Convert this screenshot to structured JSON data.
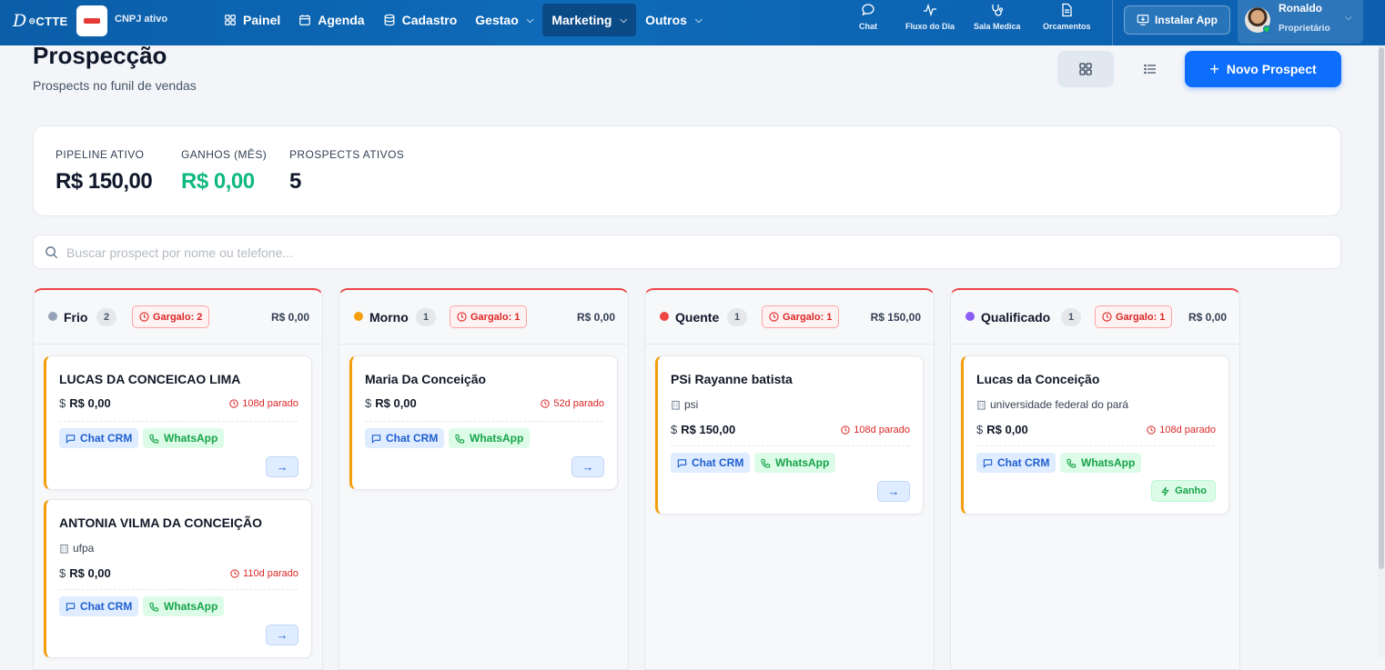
{
  "topbar": {
    "logo_d": "D",
    "logo_text": "CTTE",
    "cnpj_status": "CNPJ ativo",
    "nav": [
      {
        "label": "Painel",
        "icon": "grid-icon"
      },
      {
        "label": "Agenda",
        "icon": "calendar-icon"
      },
      {
        "label": "Cadastro",
        "icon": "database-icon"
      },
      {
        "label": "Gestao",
        "icon": "chevron-down-icon"
      },
      {
        "label": "Marketing",
        "icon": "chevron-down-icon",
        "active": true
      },
      {
        "label": "Outros",
        "icon": "chevron-down-icon"
      }
    ],
    "quick": [
      {
        "label": "Chat",
        "icon": "chat-bubble-icon"
      },
      {
        "label": "Fluxo do Dia",
        "icon": "activity-icon"
      },
      {
        "label": "Sala Medica",
        "icon": "stethoscope-icon"
      },
      {
        "label": "Orcamentos",
        "icon": "document-icon"
      }
    ],
    "install_label": "Instalar App",
    "user": {
      "name": "Ronaldo",
      "role": "Proprietário"
    }
  },
  "page": {
    "title": "Prospecção",
    "subtitle": "Prospects no funil de vendas",
    "new_button": "Novo Prospect"
  },
  "stats": [
    {
      "label": "PIPELINE ATIVO",
      "value": "R$ 150,00",
      "color": "#0f172a"
    },
    {
      "label": "GANHOS (MÊS)",
      "value": "R$ 0,00",
      "color": "#10b981"
    },
    {
      "label": "PROSPECTS ATIVOS",
      "value": "5",
      "color": "#0f172a"
    }
  ],
  "search": {
    "placeholder": "Buscar prospect por nome ou telefone..."
  },
  "columns": [
    {
      "name": "Frio",
      "count": "2",
      "bottleneck": "Gargalo: 2",
      "total": "R$ 0,00",
      "dot_color": "#94a3b8",
      "cards": [
        {
          "name": "LUCAS DA CONCEICAO LIMA",
          "amount": "R$ 0,00",
          "stale": "108d parado",
          "crm": "Chat CRM",
          "whatsapp": "WhatsApp"
        },
        {
          "name": "ANTONIA VILMA DA CONCEIÇÃO",
          "company": "ufpa",
          "amount": "R$ 0,00",
          "stale": "110d parado",
          "crm": "Chat CRM",
          "whatsapp": "WhatsApp"
        }
      ]
    },
    {
      "name": "Morno",
      "count": "1",
      "bottleneck": "Gargalo: 1",
      "total": "R$ 0,00",
      "dot_color": "#f59e0b",
      "cards": [
        {
          "name": "Maria Da Conceição",
          "amount": "R$ 0,00",
          "stale": "52d parado",
          "crm": "Chat CRM",
          "whatsapp": "WhatsApp"
        }
      ]
    },
    {
      "name": "Quente",
      "count": "1",
      "bottleneck": "Gargalo: 1",
      "total": "R$ 150,00",
      "dot_color": "#ef4444",
      "cards": [
        {
          "name": "PSi Rayanne batista",
          "company": "psi",
          "amount": "R$ 150,00",
          "stale": "108d parado",
          "crm": "Chat CRM",
          "whatsapp": "WhatsApp"
        }
      ]
    },
    {
      "name": "Qualificado",
      "count": "1",
      "bottleneck": "Gargalo: 1",
      "total": "R$ 0,00",
      "dot_color": "#8b5cf6",
      "cards": [
        {
          "name": "Lucas da Conceição",
          "company": "universidade federal do pará",
          "amount": "R$ 0,00",
          "stale": "108d parado",
          "crm": "Chat CRM",
          "whatsapp": "WhatsApp",
          "won": "Ganho"
        }
      ]
    }
  ],
  "currency_symbol": "$"
}
